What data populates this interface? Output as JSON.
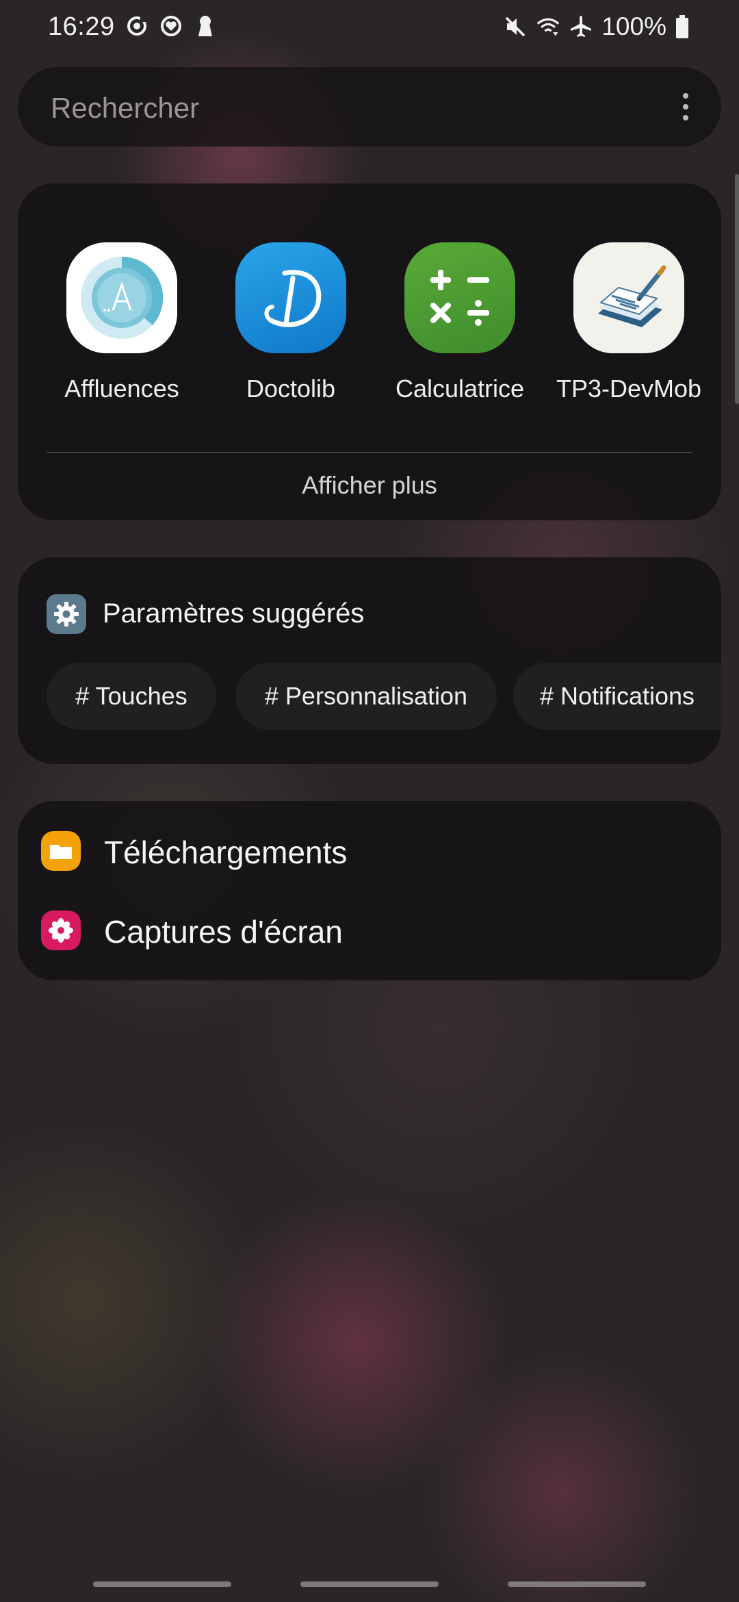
{
  "status_bar": {
    "time": "16:29",
    "left_icons": [
      "sync-icon",
      "heart-shield-icon",
      "keyhole-icon"
    ],
    "right_icons": [
      "mute-icon",
      "wifi-icon",
      "airplane-icon",
      "battery-icon"
    ],
    "battery": "100%"
  },
  "search": {
    "placeholder": "Rechercher",
    "more_icon": "more-vertical-icon"
  },
  "apps": {
    "items": [
      {
        "label": "Affluences",
        "icon": "affluences-app-icon"
      },
      {
        "label": "Doctolib",
        "icon": "doctolib-app-icon"
      },
      {
        "label": "Calculatrice",
        "icon": "calculator-app-icon"
      },
      {
        "label": "TP3-DevMob",
        "icon": "notes-app-icon"
      }
    ],
    "show_more_label": "Afficher plus"
  },
  "settings": {
    "title": "Paramètres suggérés",
    "icon": "gear-icon",
    "chips": [
      "# Touches",
      "# Personnalisation",
      "# Notifications"
    ]
  },
  "files": {
    "items": [
      {
        "label": "Téléchargements",
        "icon": "folder-icon",
        "color": "#f5a20a"
      },
      {
        "label": "Captures d'écran",
        "icon": "flower-icon",
        "color": "#d81b60"
      }
    ]
  },
  "colors": {
    "card_background": "#151315",
    "settings_icon": "#5d7a8d",
    "calculator_green": "#4f9a34",
    "doctolib_blue": "#1b8fd6"
  }
}
